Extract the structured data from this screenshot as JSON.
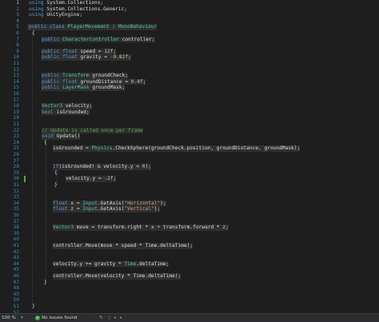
{
  "gutter": {
    "numbers": [
      "1",
      "2",
      "3",
      "4",
      "5",
      "6",
      "7",
      "8",
      "9",
      "10",
      "11",
      "12",
      "13",
      "14",
      "15",
      "16",
      "17",
      "18",
      "19",
      "20",
      "21",
      "22",
      "23",
      "24",
      "25",
      "26",
      "27",
      "28",
      "29",
      "30",
      "31",
      "32",
      "33",
      "34",
      "35",
      "36",
      "37",
      "38",
      "39",
      "40",
      "41",
      "42",
      "43",
      "44",
      "45",
      "46",
      "47",
      "48",
      "49",
      "50",
      "51",
      "52"
    ],
    "current_line": "1"
  },
  "code": {
    "l1": [
      "using",
      "System.Collections;"
    ],
    "l2": [
      "using",
      "System.Collections.Generic;"
    ],
    "l3": [
      "using",
      "UnityEngine;"
    ],
    "l5": [
      "public",
      "class",
      "PlayerMovement",
      ":",
      "MonoBehaviour"
    ],
    "l6": "{",
    "l7": [
      "public",
      "CharacterController",
      "controller;"
    ],
    "l9": [
      "public",
      "float",
      "speed",
      "=",
      "12f",
      ";"
    ],
    "l10": [
      "public",
      "float",
      "gravity",
      "=",
      "-9.82f",
      ";"
    ],
    "l13": [
      "public",
      "Transform",
      "groundCheck;"
    ],
    "l14": [
      "public",
      "float",
      "groundDistance",
      "=",
      "0.4f",
      ";"
    ],
    "l15": [
      "public",
      "LayerMask",
      "groundMask;"
    ],
    "l18": [
      "Vector3",
      "velocity;"
    ],
    "l19": [
      "bool",
      "isGrounded;"
    ],
    "l22": "// Update is called once per frame",
    "l23": [
      "void",
      "Update()"
    ],
    "l24": "{",
    "l25": [
      "isGrounded = ",
      "Physics",
      ".CheckSphere(groundCheck.position, groundDistance, groundMask);"
    ],
    "l28": [
      "if",
      "(isGrounded) & velocity.y < ",
      "0",
      ");"
    ],
    "l29": "{",
    "l30": [
      "velocity.y = ",
      "-2f",
      ";"
    ],
    "l31": "}",
    "l34": [
      "float",
      "x",
      " = ",
      "Input",
      ".GetAxis(",
      "\"Horizontal\"",
      ");"
    ],
    "l35": [
      "float",
      "z",
      " = ",
      "Input",
      ".GetAxis(",
      "\"Vertical\"",
      ");"
    ],
    "l38": [
      "Vector3",
      "move",
      " = transform.right * x + transform.forward * z;"
    ],
    "l41": "controller.Move(move * speed * Time.deltaTime);",
    "l44": [
      "velocity.y += gravity * ",
      "Time",
      ".deltaTime;"
    ],
    "l47": "controller.Move(velocity * Time.deltaTime);",
    "l48": "}",
    "l52": "}"
  },
  "statusbar": {
    "zoom": "100 %",
    "issues": "No issues found",
    "ok_icon": "check-circle-icon",
    "filter_icon": "brush-icon"
  },
  "colors": {
    "background": "#1e1e1e",
    "keyword": "#569cd6",
    "type": "#4ec9b0",
    "string": "#d69d85",
    "comment": "#57a64a",
    "line_number": "#2b91af"
  }
}
